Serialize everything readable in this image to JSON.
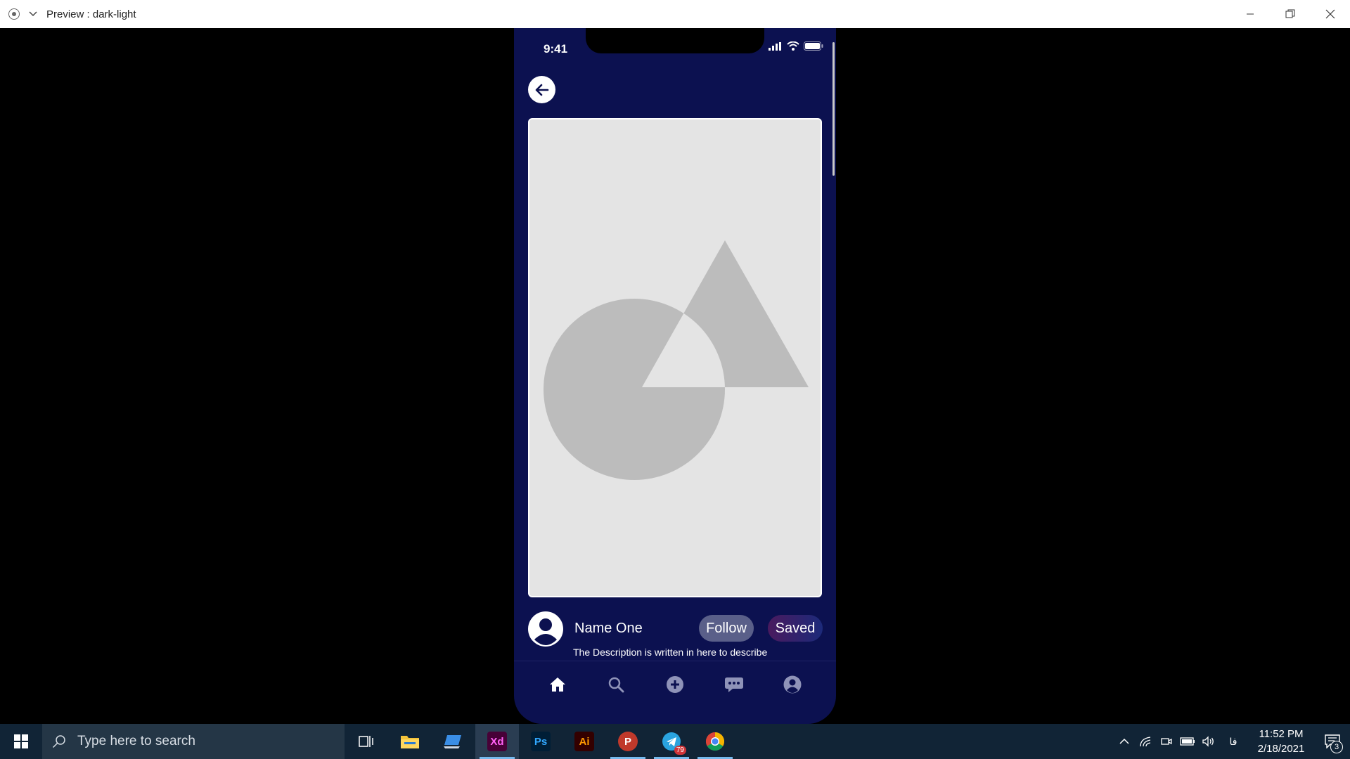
{
  "window": {
    "title": "Preview : dark-light"
  },
  "phone": {
    "status_time": "9:41",
    "post": {
      "username": "Name One",
      "follow_label": "Follow",
      "saved_label": "Saved",
      "description": "The Description is written in here to describe"
    },
    "bottom_nav": [
      "home-icon",
      "search-icon",
      "add-icon",
      "chat-icon",
      "profile-icon"
    ]
  },
  "taskbar": {
    "search_placeholder": "Type here to search",
    "apps": [
      {
        "name": "task-view",
        "label": ""
      },
      {
        "name": "file-explorer",
        "label": ""
      },
      {
        "name": "app",
        "label": ""
      },
      {
        "name": "adobe-xd",
        "label": "Xd"
      },
      {
        "name": "photoshop",
        "label": "Ps"
      },
      {
        "name": "illustrator",
        "label": "Ai"
      },
      {
        "name": "psiphon",
        "label": "P"
      },
      {
        "name": "telegram",
        "label": "",
        "badge": "79"
      },
      {
        "name": "chrome",
        "label": ""
      }
    ],
    "lang": "فا",
    "time": "11:52 PM",
    "date": "2/18/2021",
    "notification_count": "3"
  },
  "colors": {
    "phone_bg": "#0c1150",
    "placeholder_bg": "#e4e4e4",
    "shape_gray": "#bcbcbc",
    "follow_bg": "#5a5f89",
    "taskbar_bg": "#112436"
  }
}
